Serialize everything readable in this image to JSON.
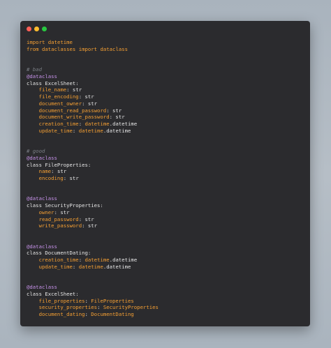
{
  "window": {
    "controls": [
      {
        "name": "close",
        "color": "#ff5f57"
      },
      {
        "name": "minimize",
        "color": "#febc2e"
      },
      {
        "name": "maximize",
        "color": "#28c840"
      }
    ]
  },
  "code_lines": [
    [
      {
        "k": "kw",
        "t": "import"
      },
      {
        "k": "plain",
        "t": " "
      },
      {
        "k": "kw",
        "t": "datetime"
      }
    ],
    [
      {
        "k": "kw",
        "t": "from"
      },
      {
        "k": "plain",
        "t": " "
      },
      {
        "k": "kw",
        "t": "dataclasses"
      },
      {
        "k": "plain",
        "t": " "
      },
      {
        "k": "kw",
        "t": "import"
      },
      {
        "k": "plain",
        "t": " "
      },
      {
        "k": "kw",
        "t": "dataclass"
      }
    ],
    [],
    [],
    [
      {
        "k": "comment",
        "t": "# bad"
      }
    ],
    [
      {
        "k": "deco",
        "t": "@dataclass"
      }
    ],
    [
      {
        "k": "plain",
        "t": "class ExcelSheet:"
      }
    ],
    [
      {
        "k": "plain",
        "t": "    "
      },
      {
        "k": "attr",
        "t": "file_name"
      },
      {
        "k": "punct",
        "t": ": "
      },
      {
        "k": "type",
        "t": "str"
      }
    ],
    [
      {
        "k": "plain",
        "t": "    "
      },
      {
        "k": "attr",
        "t": "file_encoding"
      },
      {
        "k": "punct",
        "t": ": "
      },
      {
        "k": "type",
        "t": "str"
      }
    ],
    [
      {
        "k": "plain",
        "t": "    "
      },
      {
        "k": "attr",
        "t": "document_owner"
      },
      {
        "k": "punct",
        "t": ": "
      },
      {
        "k": "type",
        "t": "str"
      }
    ],
    [
      {
        "k": "plain",
        "t": "    "
      },
      {
        "k": "attr",
        "t": "document_read_password"
      },
      {
        "k": "punct",
        "t": ": "
      },
      {
        "k": "type",
        "t": "str"
      }
    ],
    [
      {
        "k": "plain",
        "t": "    "
      },
      {
        "k": "attr",
        "t": "document_write_password"
      },
      {
        "k": "punct",
        "t": ": "
      },
      {
        "k": "type",
        "t": "str"
      }
    ],
    [
      {
        "k": "plain",
        "t": "    "
      },
      {
        "k": "attr",
        "t": "creation_time"
      },
      {
        "k": "punct",
        "t": ": "
      },
      {
        "k": "attr",
        "t": "datetime"
      },
      {
        "k": "punct",
        "t": "."
      },
      {
        "k": "type",
        "t": "datetime"
      }
    ],
    [
      {
        "k": "plain",
        "t": "    "
      },
      {
        "k": "attr",
        "t": "update_time"
      },
      {
        "k": "punct",
        "t": ": "
      },
      {
        "k": "attr",
        "t": "datetime"
      },
      {
        "k": "punct",
        "t": "."
      },
      {
        "k": "type",
        "t": "datetime"
      }
    ],
    [],
    [],
    [
      {
        "k": "comment",
        "t": "# good"
      }
    ],
    [
      {
        "k": "deco",
        "t": "@dataclass"
      }
    ],
    [
      {
        "k": "plain",
        "t": "class FileProperties:"
      }
    ],
    [
      {
        "k": "plain",
        "t": "    "
      },
      {
        "k": "attr",
        "t": "name"
      },
      {
        "k": "punct",
        "t": ": "
      },
      {
        "k": "type",
        "t": "str"
      }
    ],
    [
      {
        "k": "plain",
        "t": "    "
      },
      {
        "k": "attr",
        "t": "encoding"
      },
      {
        "k": "punct",
        "t": ": "
      },
      {
        "k": "type",
        "t": "str"
      }
    ],
    [],
    [],
    [
      {
        "k": "deco",
        "t": "@dataclass"
      }
    ],
    [
      {
        "k": "plain",
        "t": "class SecurityProperties:"
      }
    ],
    [
      {
        "k": "plain",
        "t": "    "
      },
      {
        "k": "attr",
        "t": "owner"
      },
      {
        "k": "punct",
        "t": ": "
      },
      {
        "k": "type",
        "t": "str"
      }
    ],
    [
      {
        "k": "plain",
        "t": "    "
      },
      {
        "k": "attr",
        "t": "read_password"
      },
      {
        "k": "punct",
        "t": ": "
      },
      {
        "k": "type",
        "t": "str"
      }
    ],
    [
      {
        "k": "plain",
        "t": "    "
      },
      {
        "k": "attr",
        "t": "write_password"
      },
      {
        "k": "punct",
        "t": ": "
      },
      {
        "k": "type",
        "t": "str"
      }
    ],
    [],
    [],
    [
      {
        "k": "deco",
        "t": "@dataclass"
      }
    ],
    [
      {
        "k": "plain",
        "t": "class DocumentDating:"
      }
    ],
    [
      {
        "k": "plain",
        "t": "    "
      },
      {
        "k": "attr",
        "t": "creation_time"
      },
      {
        "k": "punct",
        "t": ": "
      },
      {
        "k": "attr",
        "t": "datetime"
      },
      {
        "k": "punct",
        "t": "."
      },
      {
        "k": "type",
        "t": "datetime"
      }
    ],
    [
      {
        "k": "plain",
        "t": "    "
      },
      {
        "k": "attr",
        "t": "update_time"
      },
      {
        "k": "punct",
        "t": ": "
      },
      {
        "k": "attr",
        "t": "datetime"
      },
      {
        "k": "punct",
        "t": "."
      },
      {
        "k": "type",
        "t": "datetime"
      }
    ],
    [],
    [],
    [
      {
        "k": "deco",
        "t": "@dataclass"
      }
    ],
    [
      {
        "k": "plain",
        "t": "class ExcelSheet:"
      }
    ],
    [
      {
        "k": "plain",
        "t": "    "
      },
      {
        "k": "attr",
        "t": "file_properties"
      },
      {
        "k": "punct",
        "t": ": "
      },
      {
        "k": "attr",
        "t": "FileProperties"
      }
    ],
    [
      {
        "k": "plain",
        "t": "    "
      },
      {
        "k": "attr",
        "t": "security_properties"
      },
      {
        "k": "punct",
        "t": ": "
      },
      {
        "k": "attr",
        "t": "SecurityProperties"
      }
    ],
    [
      {
        "k": "plain",
        "t": "    "
      },
      {
        "k": "attr",
        "t": "document_dating"
      },
      {
        "k": "punct",
        "t": ": "
      },
      {
        "k": "attr",
        "t": "DocumentDating"
      }
    ]
  ]
}
